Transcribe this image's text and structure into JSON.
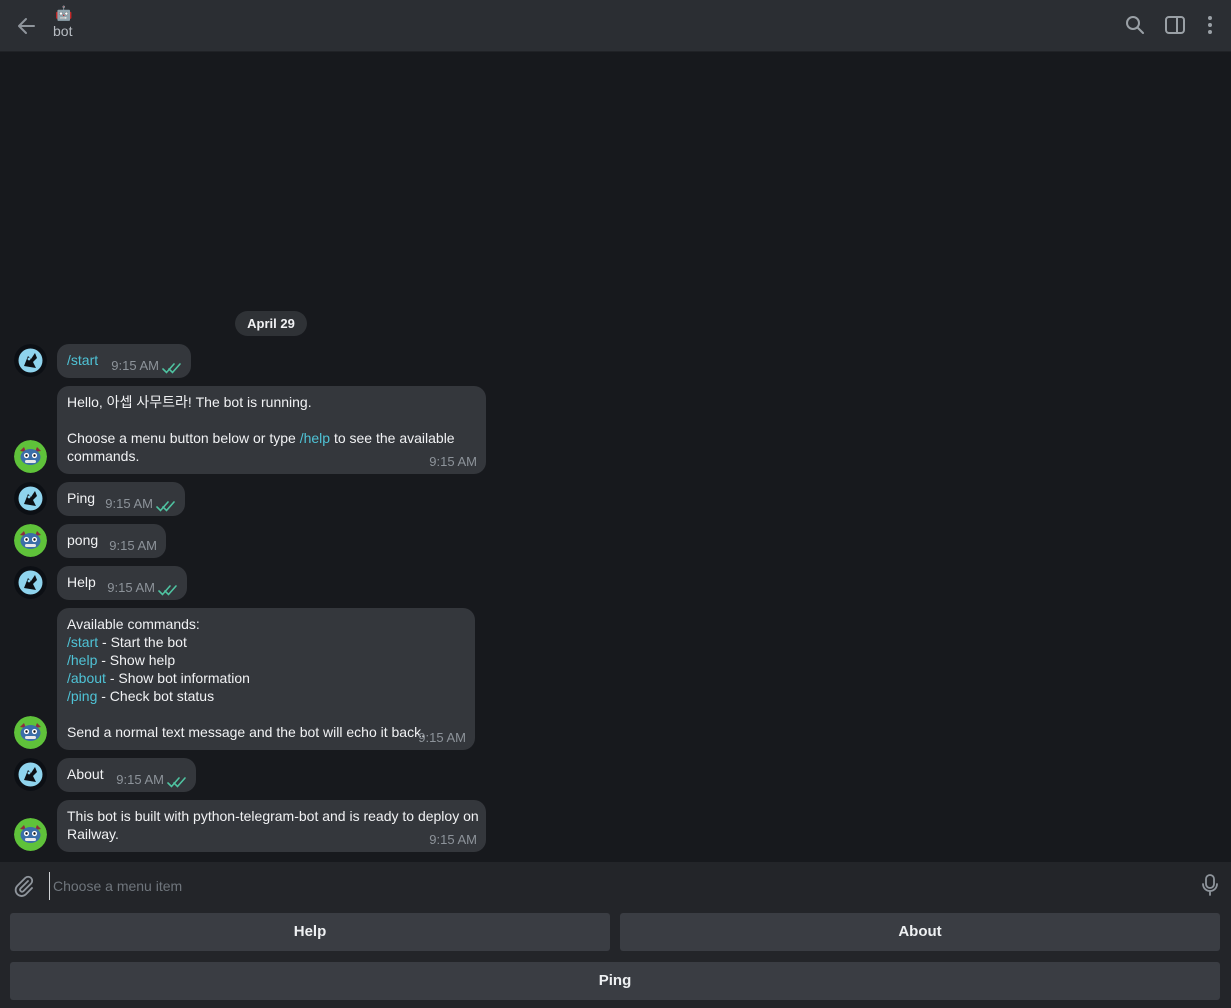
{
  "header": {
    "emoji": "🤖",
    "title": "bot",
    "icons": [
      "back-arrow-icon",
      "search-icon",
      "sidebar-toggle-icon",
      "more-vertical-icon"
    ]
  },
  "date_separator": "April 29",
  "messages": [
    {
      "from": "user",
      "lines": [
        [
          {
            "t": "/start",
            "cmd": true
          }
        ]
      ],
      "time": "9:15 AM",
      "read": true
    },
    {
      "from": "bot",
      "lines": [
        [
          {
            "t": "Hello, 아셉 사무트라! The bot is running."
          }
        ],
        [],
        [
          {
            "t": "Choose a menu button below or type "
          },
          {
            "t": "/help",
            "cmd": true
          },
          {
            "t": " to see the available"
          }
        ],
        [
          {
            "t": "commands."
          }
        ]
      ],
      "time": "9:15 AM"
    },
    {
      "from": "user",
      "lines": [
        [
          {
            "t": "Ping"
          }
        ]
      ],
      "time": "9:15 AM",
      "read": true
    },
    {
      "from": "bot",
      "lines": [
        [
          {
            "t": "pong"
          }
        ]
      ],
      "time": "9:15 AM"
    },
    {
      "from": "user",
      "lines": [
        [
          {
            "t": "Help"
          }
        ]
      ],
      "time": "9:15 AM",
      "read": true
    },
    {
      "from": "bot",
      "lines": [
        [
          {
            "t": "Available commands:"
          }
        ],
        [
          {
            "t": "/start",
            "cmd": true
          },
          {
            "t": " - Start the bot"
          }
        ],
        [
          {
            "t": "/help",
            "cmd": true
          },
          {
            "t": " - Show help"
          }
        ],
        [
          {
            "t": "/about",
            "cmd": true
          },
          {
            "t": " - Show bot information"
          }
        ],
        [
          {
            "t": "/ping",
            "cmd": true
          },
          {
            "t": " - Check bot status"
          }
        ],
        [],
        [
          {
            "t": "Send a normal text message and the bot will echo it back."
          }
        ]
      ],
      "time": "9:15 AM"
    },
    {
      "from": "user",
      "lines": [
        [
          {
            "t": "About"
          }
        ]
      ],
      "time": "9:15 AM",
      "read": true
    },
    {
      "from": "bot",
      "lines": [
        [
          {
            "t": "This bot is built with python-telegram-bot and is ready to deploy on"
          }
        ],
        [
          {
            "t": "Railway."
          }
        ]
      ],
      "time": "9:15 AM"
    }
  ],
  "composer": {
    "placeholder": "Choose a menu item",
    "value": ""
  },
  "keyboard": {
    "help_label": "Help",
    "about_label": "About",
    "ping_label": "Ping"
  },
  "colors": {
    "background": "#17191d",
    "bubble": "#34373c",
    "command_link": "#4fc3d6",
    "read_ticks": "#4fc3a1",
    "keyboard_button": "#3a3d43"
  }
}
